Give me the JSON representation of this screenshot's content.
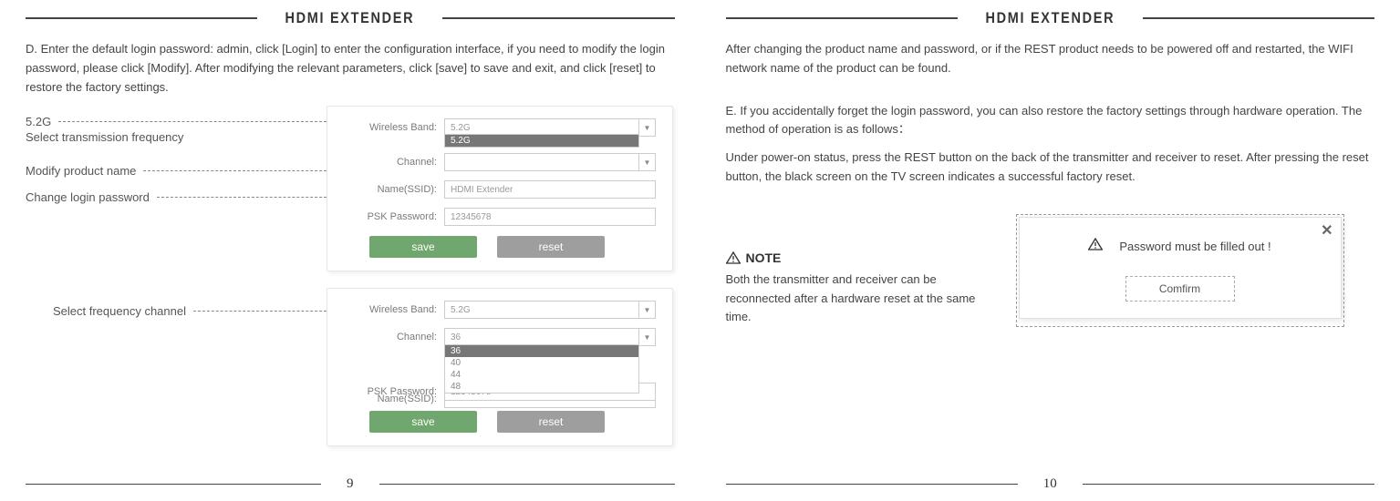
{
  "header_title": "HDMI EXTENDER",
  "left": {
    "intro": "D.  Enter the default login password: admin, click [Login] to enter the configuration interface, if you need to modify the login password, please click [Modify]. After modifying the relevant parameters, click [save] to save and exit, and click [reset] to restore the factory settings.",
    "ann1_line1": "5.2G",
    "ann1_line2": "Select transmission frequency",
    "ann2": "Modify product name",
    "ann3": "Change login password",
    "ann4": "Select frequency channel",
    "form": {
      "wireless_band_label": "Wireless Band:",
      "channel_label": "Channel:",
      "name_label": "Name(SSID):",
      "psk_label": "PSK Password:",
      "save": "save",
      "reset": "reset"
    },
    "panel1": {
      "band_value": "5.2G",
      "band_opt_sel": "5.2G",
      "channel_value": "",
      "name_value": "HDMI Extender",
      "psk_value": "12345678"
    },
    "panel2": {
      "band_value": "5.2G",
      "channel_value": "36",
      "channel_opts": {
        "o1": "36",
        "o2": "40",
        "o3": "44",
        "o4": "48"
      },
      "name_value": "",
      "psk_value": "12345678"
    },
    "page_num": "9"
  },
  "right": {
    "para1": "After changing the product name and password, or if the REST product needs to be powered off and restarted, the WIFI network name of the product can be found.",
    "para2": "E.  If you accidentally forget the login password, you can also restore the factory settings through hardware operation. The method of operation is as follows：",
    "para3": "Under power-on status, press the REST button on the back of the transmitter and receiver to reset. After pressing the reset button, the black screen on the TV screen indicates a successful factory reset.",
    "note_title": "NOTE",
    "note_body": "Both the transmitter and receiver can be reconnected after a hardware reset at the same time.",
    "dialog_msg": "Password must be filled out !",
    "dialog_btn": "Comfirm",
    "page_num": "10"
  }
}
